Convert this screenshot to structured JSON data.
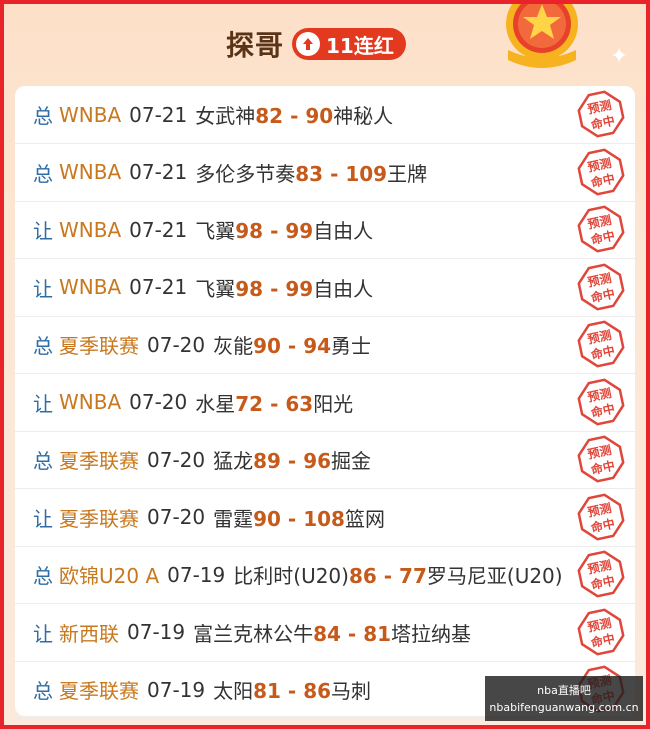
{
  "header": {
    "title": "探哥",
    "streak_label": "11连红"
  },
  "colors": {
    "border": "#e8232a",
    "type_blue": "#2f6ca4",
    "league_orange": "#c8781e",
    "score_orange": "#c65a1a",
    "stamp_red": "#e0463a"
  },
  "rows": [
    {
      "type": "总",
      "league": "WNBA",
      "date": "07-21",
      "home": "女武神",
      "home_score": "82",
      "sep": " - ",
      "away_score": "90",
      "away": "神秘人",
      "stamp": "预测命中"
    },
    {
      "type": "总",
      "league": "WNBA",
      "date": "07-21",
      "home": "多伦多节奏",
      "home_score": "83",
      "sep": " - ",
      "away_score": "109",
      "away": "王牌",
      "stamp": "预测命中"
    },
    {
      "type": "让",
      "league": "WNBA",
      "date": "07-21",
      "home": "飞翼",
      "home_score": "98",
      "sep": " - ",
      "away_score": "99",
      "away": "自由人",
      "stamp": "预测命中"
    },
    {
      "type": "让",
      "league": "WNBA",
      "date": "07-21",
      "home": "飞翼",
      "home_score": "98",
      "sep": " - ",
      "away_score": "99",
      "away": "自由人",
      "stamp": "预测命中"
    },
    {
      "type": "总",
      "league": "夏季联赛",
      "date": "07-20",
      "home": "灰能",
      "home_score": "90",
      "sep": " - ",
      "away_score": "94",
      "away": "勇士",
      "stamp": "预测命中"
    },
    {
      "type": "让",
      "league": "WNBA",
      "date": "07-20",
      "home": "水星",
      "home_score": "72",
      "sep": " - ",
      "away_score": "63",
      "away": "阳光",
      "stamp": "预测命中"
    },
    {
      "type": "总",
      "league": "夏季联赛",
      "date": "07-20",
      "home": "猛龙",
      "home_score": "89",
      "sep": " - ",
      "away_score": "96",
      "away": "掘金",
      "stamp": "预测命中"
    },
    {
      "type": "让",
      "league": "夏季联赛",
      "date": "07-20",
      "home": "雷霆",
      "home_score": "90",
      "sep": " - ",
      "away_score": "108",
      "away": "篮网",
      "stamp": "预测命中"
    },
    {
      "type": "总",
      "league": "欧锦U20 A",
      "date": "07-19",
      "home": "比利时(U20)",
      "home_score": "86",
      "sep": " - ",
      "away_score": "77",
      "away": "罗马尼亚(U20)",
      "stamp": "预测命中"
    },
    {
      "type": "让",
      "league": "新西联",
      "date": "07-19",
      "home": "富兰克林公牛",
      "home_score": "84",
      "sep": " - ",
      "away_score": "81",
      "away": "塔拉纳基",
      "stamp": "预测命中"
    },
    {
      "type": "总",
      "league": "夏季联赛",
      "date": "07-19",
      "home": "太阳",
      "home_score": "81",
      "sep": " - ",
      "away_score": "86",
      "away": "马刺",
      "stamp": "预测命中"
    }
  ],
  "watermark": {
    "line1": "nba直播吧",
    "line2": "nbabifenguanwang.com.cn"
  }
}
